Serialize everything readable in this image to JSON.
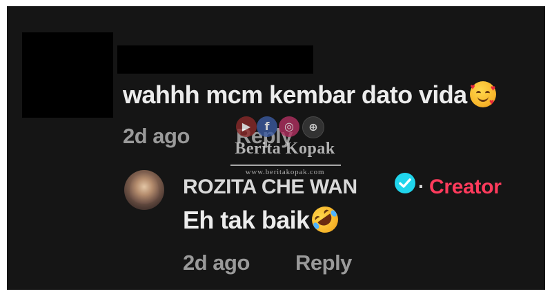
{
  "comment": {
    "text": "wahhh mcm kembar dato vida",
    "emoji_icon": "smiling-face-with-hearts-icon",
    "time": "2d ago",
    "reply_label": "Reply"
  },
  "reply": {
    "author": "ROZITA CHE WAN",
    "verified_icon": "verified-badge-icon",
    "separator": "·",
    "badge_label": "Creator",
    "text": "Eh tak baik",
    "emoji_icon": "rolling-on-floor-laughing-icon",
    "time": "2d ago",
    "reply_label": "Reply"
  },
  "watermark": {
    "title": "Berita Kopak",
    "url": "www.beritakopak.com",
    "icons": [
      "youtube-icon",
      "facebook-icon",
      "instagram-icon",
      "globe-icon"
    ]
  },
  "colors": {
    "background": "#151515",
    "primary_text": "#ececec",
    "secondary_text": "#9a9a9a",
    "creator_accent": "#ff3b5c",
    "verified": "#20d5ec"
  }
}
